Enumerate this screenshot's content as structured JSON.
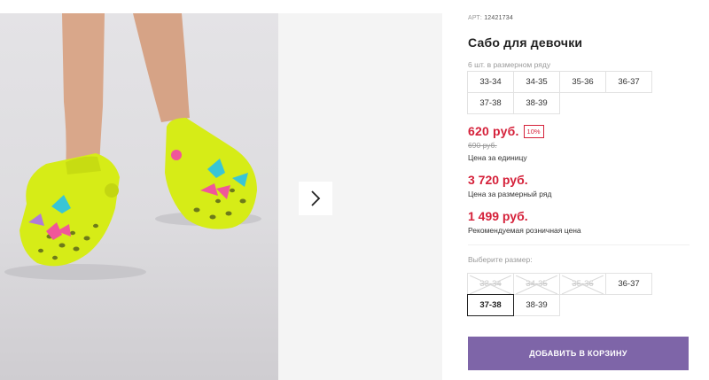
{
  "gallery": {
    "image_alt": "Girls' neon yellow clogs with butterfly charms",
    "next_icon": "chevron-right-icon"
  },
  "product": {
    "article_label": "АРТ:",
    "article_number": "12421734",
    "title": "Сабо для девочки",
    "sizes_note": "6 шт. в размерном ряду"
  },
  "size_range": [
    "33-34",
    "34-35",
    "35-36",
    "36-37",
    "37-38",
    "38-39"
  ],
  "pricing": {
    "price": "620 руб.",
    "discount": "10%",
    "old_price": "690 руб.",
    "unit_label": "Цена за единицу",
    "row_price": "3 720 руб.",
    "row_label": "Цена за размерный ряд",
    "rrp_price": "1 499 руб.",
    "rrp_label": "Рекомендуемая розничная цена"
  },
  "size_picker": {
    "label": "Выберите размер:",
    "options": [
      {
        "label": "33-34",
        "available": false
      },
      {
        "label": "34-35",
        "available": false
      },
      {
        "label": "35-36",
        "available": false
      },
      {
        "label": "36-37",
        "available": true
      },
      {
        "label": "37-38",
        "available": true,
        "selected": true
      },
      {
        "label": "38-39",
        "available": true
      }
    ]
  },
  "cart_button": {
    "label": "ДОБАВИТЬ В КОРЗИНУ"
  },
  "colors": {
    "accent": "#7e65a8",
    "price": "#d5213a",
    "clog": "#d9ee14"
  }
}
